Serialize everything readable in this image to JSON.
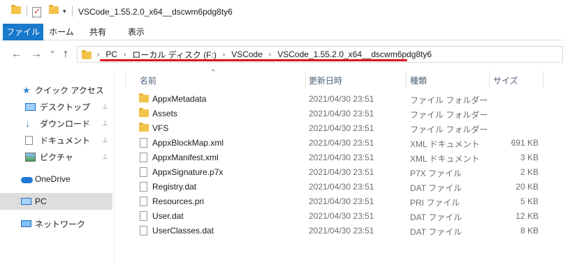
{
  "window": {
    "title": "VSCode_1.55.2.0_x64__dscwm6pdg8ty6",
    "quick_access_dropdown": "▾"
  },
  "ribbon": {
    "tabs": [
      {
        "label": "ファイル",
        "active": true
      },
      {
        "label": "ホーム"
      },
      {
        "label": "共有"
      },
      {
        "label": "表示"
      }
    ]
  },
  "nav": {
    "back": "←",
    "forward": "→",
    "history": "⌄",
    "up": "↑",
    "separator": "›",
    "breadcrumbs": [
      "PC",
      "ローカル ディスク (F:)",
      "VSCode",
      "VSCode_1.55.2.0_x64__dscwm6pdg8ty6"
    ]
  },
  "sidebar": {
    "items": [
      {
        "label": "クイック アクセス",
        "icon": "star-icon"
      },
      {
        "label": "デスクトップ",
        "icon": "desktop-icon",
        "pinned": true
      },
      {
        "label": "ダウンロード",
        "icon": "download-icon",
        "pinned": true
      },
      {
        "label": "ドキュメント",
        "icon": "document-icon",
        "pinned": true
      },
      {
        "label": "ピクチャ",
        "icon": "pictures-icon",
        "pinned": true
      },
      {
        "label": "OneDrive",
        "icon": "cloud-icon"
      },
      {
        "label": "PC",
        "icon": "pc-icon",
        "selected": true
      },
      {
        "label": "ネットワーク",
        "icon": "network-icon"
      }
    ],
    "pin_glyph": "📌"
  },
  "columns": {
    "name": "名前",
    "modified": "更新日時",
    "type": "種類",
    "size": "サイズ",
    "sort_glyph": "⌃"
  },
  "files": [
    {
      "name": "AppxMetadata",
      "modified": "2021/04/30 23:51",
      "type": "ファイル フォルダー",
      "size": "",
      "kind": "folder"
    },
    {
      "name": "Assets",
      "modified": "2021/04/30 23:51",
      "type": "ファイル フォルダー",
      "size": "",
      "kind": "folder"
    },
    {
      "name": "VFS",
      "modified": "2021/04/30 23:51",
      "type": "ファイル フォルダー",
      "size": "",
      "kind": "folder"
    },
    {
      "name": "AppxBlockMap.xml",
      "modified": "2021/04/30 23:51",
      "type": "XML ドキュメント",
      "size": "691 KB",
      "kind": "file"
    },
    {
      "name": "AppxManifest.xml",
      "modified": "2021/04/30 23:51",
      "type": "XML ドキュメント",
      "size": "3 KB",
      "kind": "file"
    },
    {
      "name": "AppxSignature.p7x",
      "modified": "2021/04/30 23:51",
      "type": "P7X ファイル",
      "size": "2 KB",
      "kind": "file"
    },
    {
      "name": "Registry.dat",
      "modified": "2021/04/30 23:51",
      "type": "DAT ファイル",
      "size": "20 KB",
      "kind": "file"
    },
    {
      "name": "Resources.pri",
      "modified": "2021/04/30 23:51",
      "type": "PRI ファイル",
      "size": "5 KB",
      "kind": "file"
    },
    {
      "name": "User.dat",
      "modified": "2021/04/30 23:51",
      "type": "DAT ファイル",
      "size": "12 KB",
      "kind": "file"
    },
    {
      "name": "UserClasses.dat",
      "modified": "2021/04/30 23:51",
      "type": "DAT ファイル",
      "size": "8 KB",
      "kind": "file"
    }
  ],
  "colors": {
    "accent": "#1979ca",
    "highlight_underline": "#e0121a",
    "folder": "#f3c34c"
  }
}
